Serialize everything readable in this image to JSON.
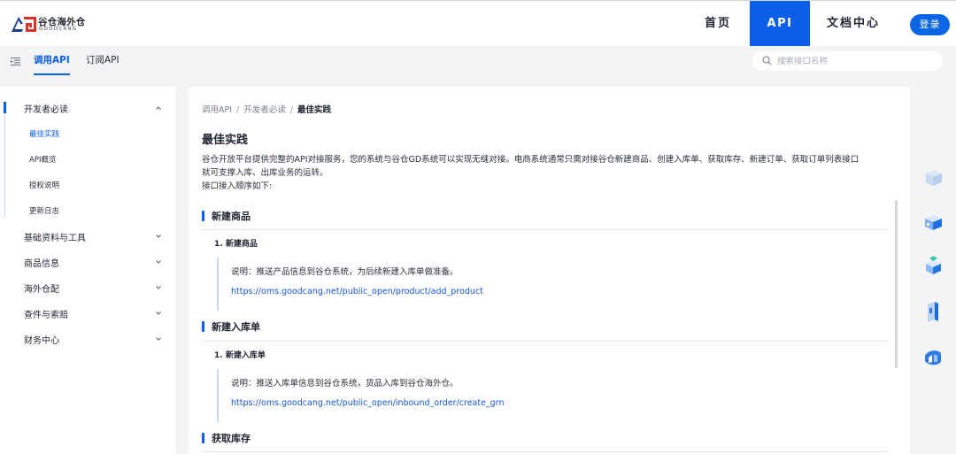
{
  "logo": {
    "name": "谷仓海外仓",
    "sub": "GOODCANG"
  },
  "nav": {
    "home": "首页",
    "api": "API",
    "docs": "文档中心",
    "login": "登录"
  },
  "tabs": [
    {
      "label": "调用API",
      "active": true
    },
    {
      "label": "订阅API",
      "active": false
    }
  ],
  "search": {
    "placeholder": "搜索接口名称"
  },
  "sidebar": {
    "groups": [
      {
        "label": "开发者必读",
        "expanded": true,
        "children": [
          {
            "label": "最佳实践",
            "active": true
          },
          {
            "label": "API概览",
            "active": false
          },
          {
            "label": "授权说明",
            "active": false
          },
          {
            "label": "更新日志",
            "active": false
          }
        ]
      },
      {
        "label": "基础资料与工具",
        "expanded": false
      },
      {
        "label": "商品信息",
        "expanded": false
      },
      {
        "label": "海外仓配",
        "expanded": false
      },
      {
        "label": "查件与索赔",
        "expanded": false
      },
      {
        "label": "财务中心",
        "expanded": false
      }
    ]
  },
  "breadcrumb": [
    "调用API",
    "开发者必读",
    "最佳实践"
  ],
  "page": {
    "title": "最佳实践",
    "intro_line1": "谷仓开放平台提供完整的API对接服务，您的系统与谷仓GD系统可以实现无缝对接。电商系统通常只需对接谷仓新建商品、创建入库单、获取库存、新建订单、获取订单列表接口",
    "intro_line2": "就可支撑入库、出库业务的运转。",
    "intro_line3": "接口接入顺序如下:",
    "sections": [
      {
        "title": "新建商品",
        "item": "1. 新建商品",
        "note": "说明：推送产品信息到谷仓系统，为后续新建入库单做准备。",
        "link": "https://oms.goodcang.net/public_open/product/add_product"
      },
      {
        "title": "新建入库单",
        "item": "1. 新建入库单",
        "note": "说明：推送入库单信息到谷仓系统，货品入库到谷仓海外仓。",
        "link": "https://oms.goodcang.net/public_open/inbound_order/create_grn"
      },
      {
        "title": "获取库存"
      }
    ]
  },
  "colors": {
    "accent": "#0b5ee8",
    "link": "#1456d6",
    "text": "#1f2430",
    "bg": "#f3f4f6"
  }
}
